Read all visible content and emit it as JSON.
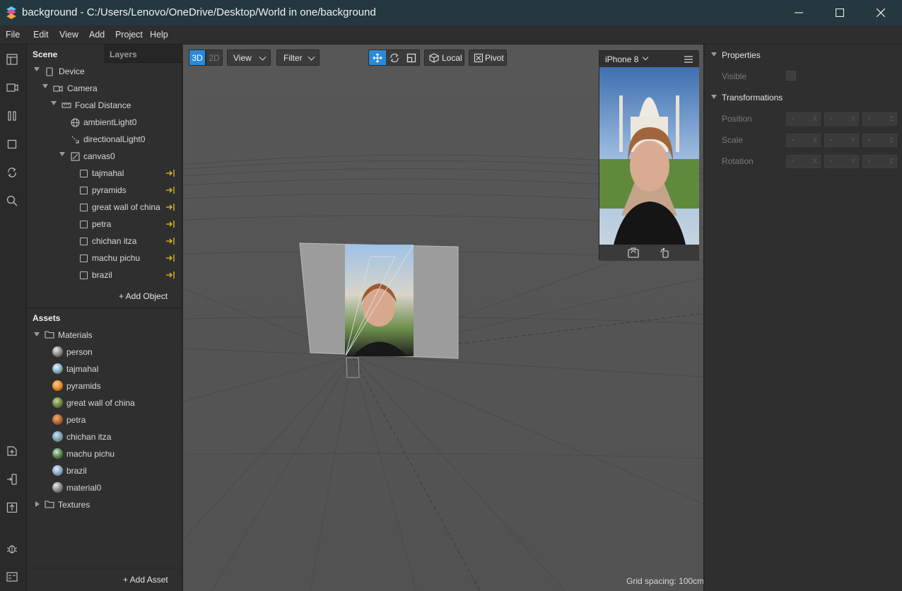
{
  "window": {
    "title": "background - C:/Users/Lenovo/OneDrive/Desktop/World in one/background",
    "minimize_icon": "minimize-icon",
    "maximize_icon": "maximize-icon",
    "close_icon": "close-icon"
  },
  "menu": [
    "File",
    "Edit",
    "View",
    "Add",
    "Project",
    "Help"
  ],
  "scene_panel": {
    "tabs": [
      "Scene",
      "Layers"
    ],
    "tree": [
      {
        "label": "Device",
        "icon": "device-icon"
      },
      {
        "label": "Camera",
        "icon": "camera-icon"
      },
      {
        "label": "Focal Distance",
        "icon": "focal-distance-icon"
      },
      {
        "label": "ambientLight0",
        "icon": "ambient-light-icon"
      },
      {
        "label": "directionalLight0",
        "icon": "directional-light-icon"
      },
      {
        "label": "canvas0",
        "icon": "canvas-icon"
      },
      {
        "label": "tajmahal",
        "icon": "rectangle-icon"
      },
      {
        "label": "pyramids",
        "icon": "rectangle-icon"
      },
      {
        "label": "great wall of china",
        "icon": "rectangle-icon"
      },
      {
        "label": "petra",
        "icon": "rectangle-icon"
      },
      {
        "label": "chichan itza",
        "icon": "rectangle-icon"
      },
      {
        "label": "machu pichu",
        "icon": "rectangle-icon"
      },
      {
        "label": "brazil",
        "icon": "rectangle-icon"
      }
    ],
    "add_object": "+ Add Object"
  },
  "assets_panel": {
    "title": "Assets",
    "materials_folder": "Materials",
    "materials": [
      "person",
      "tajmahal",
      "pyramids",
      "great wall of china",
      "petra",
      "chichan itza",
      "machu pichu",
      "brazil",
      "material0"
    ],
    "textures_folder": "Textures",
    "add_asset": "+ Add Asset"
  },
  "viewport": {
    "mode_3d": "3D",
    "mode_2d": "2D",
    "view_label": "View",
    "filter_label": "Filter",
    "local_label": "Local",
    "pivot_label": "Pivot",
    "grid_spacing": "Grid spacing: 100cm",
    "active_mode": "3D",
    "active_tool": "move"
  },
  "preview": {
    "device": "iPhone 8"
  },
  "properties": {
    "properties_title": "Properties",
    "visible_label": "Visible",
    "transformations_title": "Transformations",
    "rows": [
      {
        "label": "Position",
        "values": [
          "-",
          "-",
          "-"
        ],
        "axes": [
          "X",
          "Y",
          "Z"
        ]
      },
      {
        "label": "Scale",
        "values": [
          "-",
          "-",
          "-"
        ],
        "axes": [
          "X",
          "Y",
          "Z"
        ]
      },
      {
        "label": "Rotation",
        "values": [
          "-",
          "-",
          "-"
        ],
        "axes": [
          "X",
          "Y",
          "Z"
        ]
      }
    ]
  },
  "colors": {
    "titlebar": "#23383f",
    "accent": "#2a8ad9",
    "viewport": "#555555",
    "panel": "#2f2f2f",
    "pin": "#e6c21a"
  }
}
